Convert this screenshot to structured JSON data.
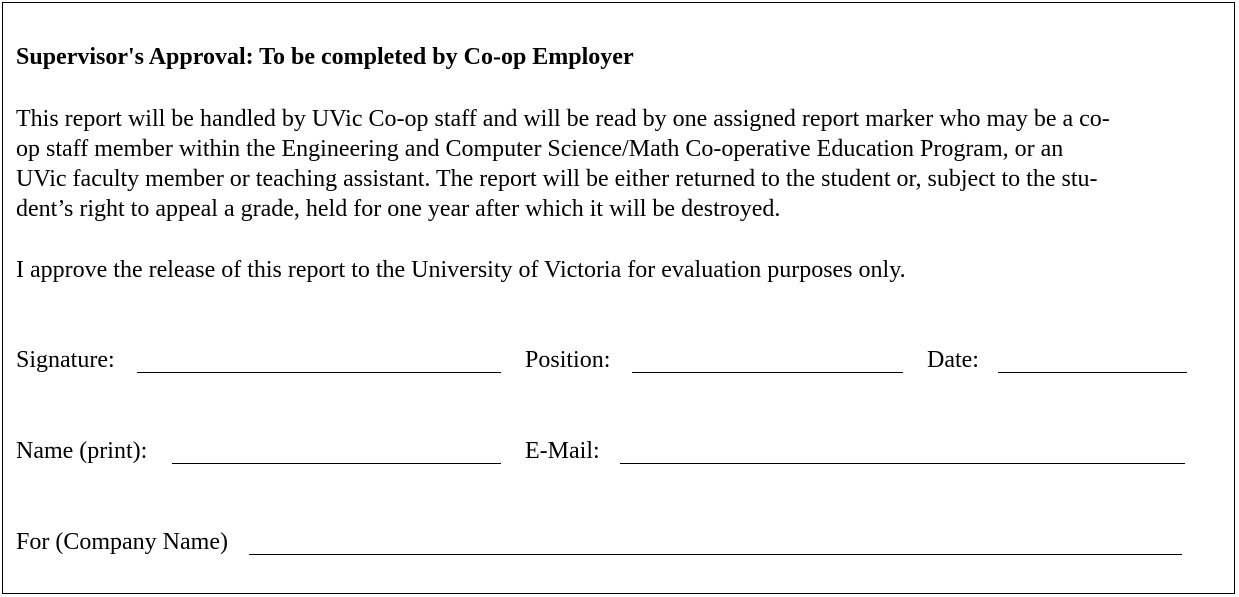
{
  "form": {
    "title": "Supervisor's Approval: To be completed by Co-op Employer",
    "paragraph_lines": [
      "This report will be handled by UVic Co-op staff and will be read by one assigned report marker who may be a co-",
      "op staff member within the Engineering and Computer Science/Math Co-operative Education Program, or an",
      "UVic faculty member or teaching assistant. The report will be either returned to the student or, subject to the stu-",
      "dent’s right to appeal a grade, held for one year after which it will be destroyed."
    ],
    "approval": "I approve the release of this report to the University of Victoria for evaluation purposes only.",
    "fields": {
      "signature_label": "Signature:",
      "position_label": "Position:",
      "date_label": "Date:",
      "name_label": "Name (print):",
      "email_label": "E-Mail:",
      "company_label": "For (Company Name)"
    }
  }
}
